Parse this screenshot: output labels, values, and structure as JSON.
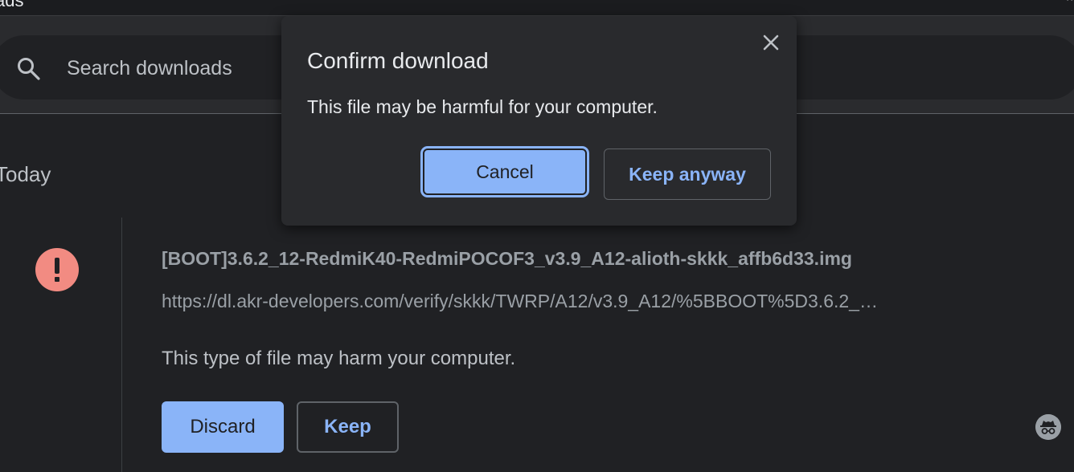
{
  "window": {
    "title_fragment": "ads",
    "corner_glyph": "^"
  },
  "search": {
    "placeholder": "Search downloads",
    "value": ""
  },
  "section": {
    "date_label": "Today"
  },
  "download": {
    "file_name": "[BOOT]3.6.2_12-RedmiK40-RedmiPOCOF3_v3.9_A12-alioth-skkk_affb6d33.img",
    "url": "https://dl.akr-developers.com/verify/skkk/TWRP/A12/v3.9_A12/%5BBOOT%5D3.6.2_…",
    "warning": "This type of file may harm your computer.",
    "discard_label": "Discard",
    "keep_label": "Keep",
    "status_icon": "error-icon"
  },
  "dialog": {
    "title": "Confirm download",
    "message": "This file may be harmful for your computer.",
    "cancel_label": "Cancel",
    "keep_anyway_label": "Keep anyway",
    "close_icon": "close-icon"
  },
  "colors": {
    "background": "#202124",
    "accent": "#8ab4f8",
    "danger": "#f28b82",
    "text": "#e8eaed",
    "muted_text": "#9aa0a6"
  }
}
